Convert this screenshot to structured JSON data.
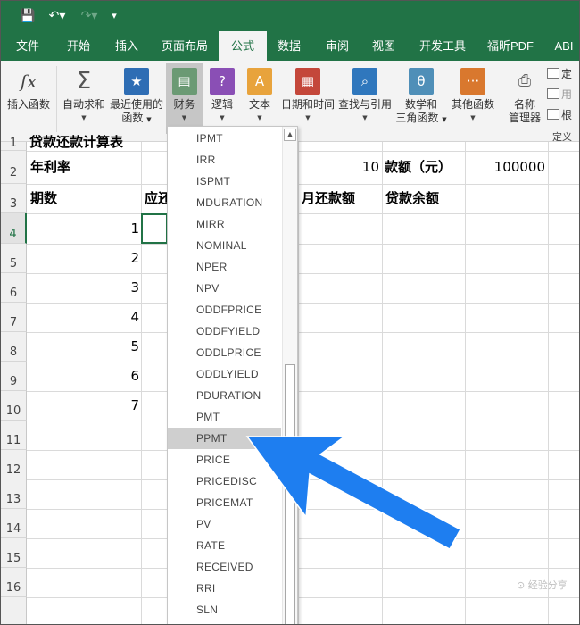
{
  "quick_access": {
    "save_icon": "💾",
    "undo_icon": "↶▾",
    "redo_icon": "↷▾",
    "more_icon": "▾"
  },
  "tabs": [
    "文件",
    "开始",
    "插入",
    "页面布局",
    "公式",
    "数据",
    "审阅",
    "视图",
    "开发工具",
    "福昕PDF",
    "ABI"
  ],
  "active_tab": "公式",
  "ribbon": {
    "insert_function": "插入函数",
    "autosum": "自动求和",
    "recent_line1": "最近使用的",
    "recent_line2": "函数",
    "financial": "财务",
    "logical": "逻辑",
    "text": "文本",
    "datetime": "日期和时间",
    "lookup": "查找与引用",
    "math_line1": "数学和",
    "math_line2": "三角函数",
    "other": "其他函数",
    "name_mgr_line1": "名称",
    "name_mgr_line2": "管理器",
    "define_name": "定",
    "use_in_formula": "用",
    "create_from_sel": "根",
    "group_label": "定义",
    "icons": {
      "fx": "fx",
      "sigma": "Σ",
      "star": "★",
      "question": "?",
      "letter_a": "A",
      "theta": "θ",
      "ellipsis": "···"
    }
  },
  "row_numbers": [
    "1",
    "2",
    "3",
    "4",
    "5",
    "6",
    "7",
    "8",
    "9",
    "10",
    "11",
    "12",
    "13",
    "14",
    "15",
    "16"
  ],
  "active_row": "4",
  "cells": {
    "r1_title": "贷款还款计算表",
    "r2_rate_label": "年利率",
    "r2_years": "10",
    "r2_amount_label": "款额（元）",
    "r2_amount": "100000",
    "r3_period": "期数",
    "r3_due": "应还",
    "r3_monthly": "月还款额",
    "r3_balance": "贷款余额",
    "periods": [
      "1",
      "2",
      "3",
      "4",
      "5",
      "6",
      "7"
    ]
  },
  "function_list": [
    "IPMT",
    "IRR",
    "ISPMT",
    "MDURATION",
    "MIRR",
    "NOMINAL",
    "NPER",
    "NPV",
    "ODDFPRICE",
    "ODDFYIELD",
    "ODDLPRICE",
    "ODDLYIELD",
    "PDURATION",
    "PMT",
    "PPMT",
    "PRICE",
    "PRICEDISC",
    "PRICEMAT",
    "PV",
    "RATE",
    "RECEIVED",
    "RRI",
    "SLN"
  ],
  "highlighted_function": "PPMT",
  "scroll_up_icon": "▲",
  "watermark": "⊙ 经验分享",
  "colors": {
    "excel_green": "#217346",
    "arrow_blue": "#1e7ef0",
    "highlight": "#cfcfcf"
  }
}
